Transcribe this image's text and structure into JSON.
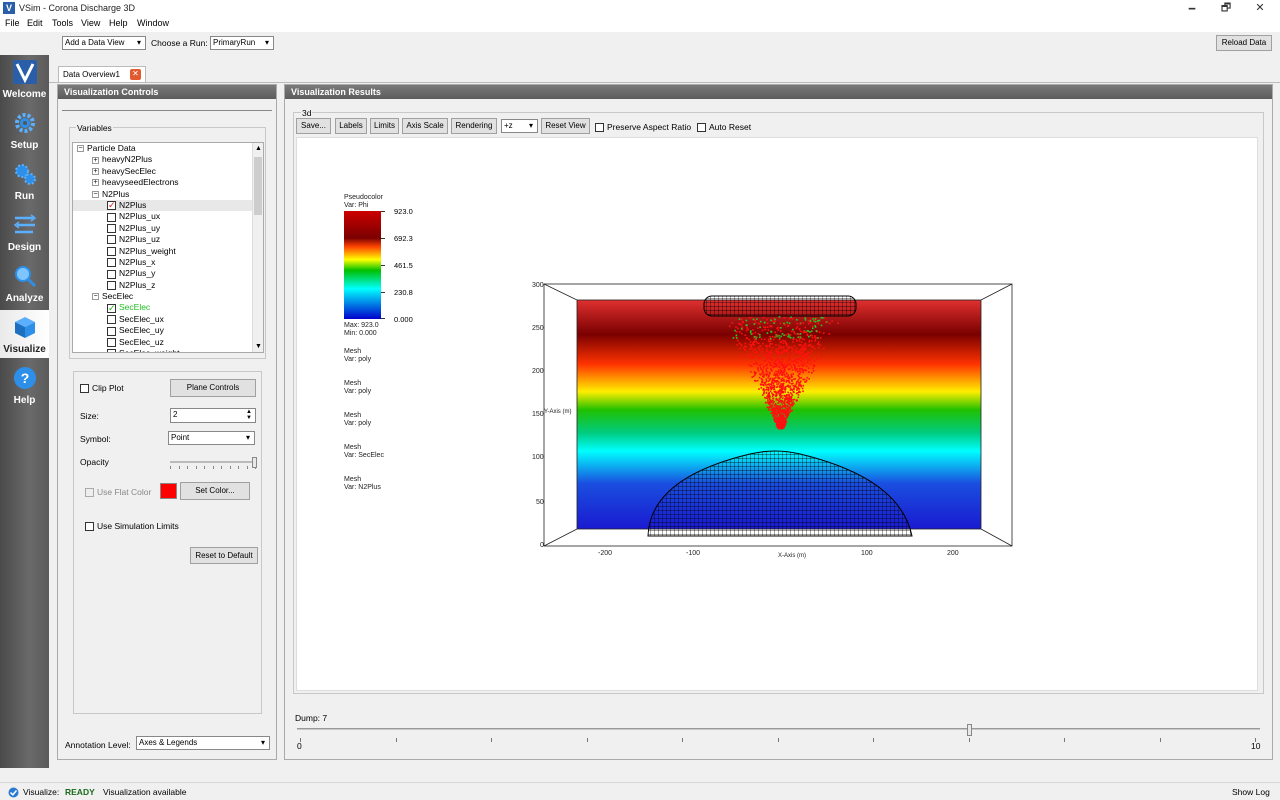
{
  "window": {
    "title": "VSim - Corona Discharge 3D",
    "minimize": "🗕",
    "maximize": "🗗",
    "close": "✕"
  },
  "menu": [
    "File",
    "Edit",
    "Tools",
    "View",
    "Help",
    "Window"
  ],
  "toolbar": {
    "add_view_label": "Add a Data View",
    "choose_run_label": "Choose a Run:",
    "run_value": "PrimaryRun",
    "reload_label": "Reload Data"
  },
  "nav": [
    {
      "label": "Welcome",
      "icon": "vsim-logo-icon"
    },
    {
      "label": "Setup",
      "icon": "gear-icon"
    },
    {
      "label": "Run",
      "icon": "gears-icon"
    },
    {
      "label": "Design",
      "icon": "design-icon"
    },
    {
      "label": "Analyze",
      "icon": "magnifier-icon"
    },
    {
      "label": "Visualize",
      "icon": "cube-icon"
    },
    {
      "label": "Help",
      "icon": "question-icon"
    }
  ],
  "tab": {
    "label": "Data Overview1"
  },
  "controls": {
    "header": "Visualization Controls",
    "variables_label": "Variables",
    "tree": [
      {
        "label": "Particle Data",
        "level": 0,
        "kind": "expanded"
      },
      {
        "label": "heavyN2Plus",
        "level": 1,
        "kind": "collapsed"
      },
      {
        "label": "heavySecElec",
        "level": 1,
        "kind": "collapsed"
      },
      {
        "label": "heavyseedElectrons",
        "level": 1,
        "kind": "collapsed"
      },
      {
        "label": "N2Plus",
        "level": 1,
        "kind": "expanded"
      },
      {
        "label": "N2Plus",
        "level": 2,
        "kind": "checked-red"
      },
      {
        "label": "N2Plus_ux",
        "level": 2,
        "kind": "unchecked"
      },
      {
        "label": "N2Plus_uy",
        "level": 2,
        "kind": "unchecked"
      },
      {
        "label": "N2Plus_uz",
        "level": 2,
        "kind": "unchecked"
      },
      {
        "label": "N2Plus_weight",
        "level": 2,
        "kind": "unchecked"
      },
      {
        "label": "N2Plus_x",
        "level": 2,
        "kind": "unchecked"
      },
      {
        "label": "N2Plus_y",
        "level": 2,
        "kind": "unchecked"
      },
      {
        "label": "N2Plus_z",
        "level": 2,
        "kind": "unchecked"
      },
      {
        "label": "SecElec",
        "level": 1,
        "kind": "expanded"
      },
      {
        "label": "SecElec",
        "level": 2,
        "kind": "checked-green"
      },
      {
        "label": "SecElec_ux",
        "level": 2,
        "kind": "unchecked"
      },
      {
        "label": "SecElec_uy",
        "level": 2,
        "kind": "unchecked"
      },
      {
        "label": "SecElec_uz",
        "level": 2,
        "kind": "unchecked"
      },
      {
        "label": "SecElec_weight",
        "level": 2,
        "kind": "unchecked"
      }
    ],
    "clip_plot_label": "Clip Plot",
    "plane_controls_label": "Plane Controls",
    "size_label": "Size:",
    "size_value": "2",
    "symbol_label": "Symbol:",
    "symbol_value": "Point",
    "opacity_label": "Opacity",
    "opacity_value": 1.0,
    "use_flat_color_label": "Use Flat Color",
    "flat_color": "#ff0000",
    "set_color_label": "Set Color...",
    "use_sim_limits_label": "Use Simulation Limits",
    "reset_default_label": "Reset to Default",
    "annotation_label": "Annotation Level:",
    "annotation_value": "Axes & Legends"
  },
  "results": {
    "header": "Visualization Results",
    "group_label": "3d",
    "buttons": {
      "save": "Save...",
      "labels": "Labels",
      "limits": "Limits",
      "axis_scale": "Axis Scale",
      "rendering": "Rendering",
      "reset_view": "Reset View"
    },
    "view_dir": "+z",
    "preserve_aspect_label": "Preserve Aspect Ratio",
    "auto_reset_label": "Auto Reset",
    "legend": {
      "title": "Pseudocolor",
      "var": "Var: Phi",
      "ticks": [
        "923.0",
        "692.3",
        "461.5",
        "230.8",
        "0.000"
      ],
      "max": "Max:  923.0",
      "min": "Min:  0.000"
    },
    "meshes": [
      {
        "title": "Mesh",
        "var": "Var: poly"
      },
      {
        "title": "Mesh",
        "var": "Var: poly"
      },
      {
        "title": "Mesh",
        "var": "Var: poly"
      },
      {
        "title": "Mesh",
        "var": "Var: SecElec"
      },
      {
        "title": "Mesh",
        "var": "Var: N2Plus"
      }
    ],
    "plot": {
      "y_ticks": [
        "300",
        "250",
        "200",
        "150",
        "100",
        "50",
        "0"
      ],
      "x_ticks": [
        "-200",
        "-100",
        "0",
        "100",
        "200"
      ],
      "x_axis_label": "X-Axis (m)",
      "y_axis_label": "Y-Axis (m)"
    },
    "dump_label": "Dump: 7",
    "dump_value": 7,
    "dump_min": "0",
    "dump_max": "10"
  },
  "status": {
    "area": "Visualize:",
    "state": "READY",
    "message": "Visualization available",
    "show_log": "Show Log"
  },
  "colors": {
    "accent": "#2a5ea8",
    "ready": "#1a6a1a",
    "panel_header": "#666666"
  }
}
